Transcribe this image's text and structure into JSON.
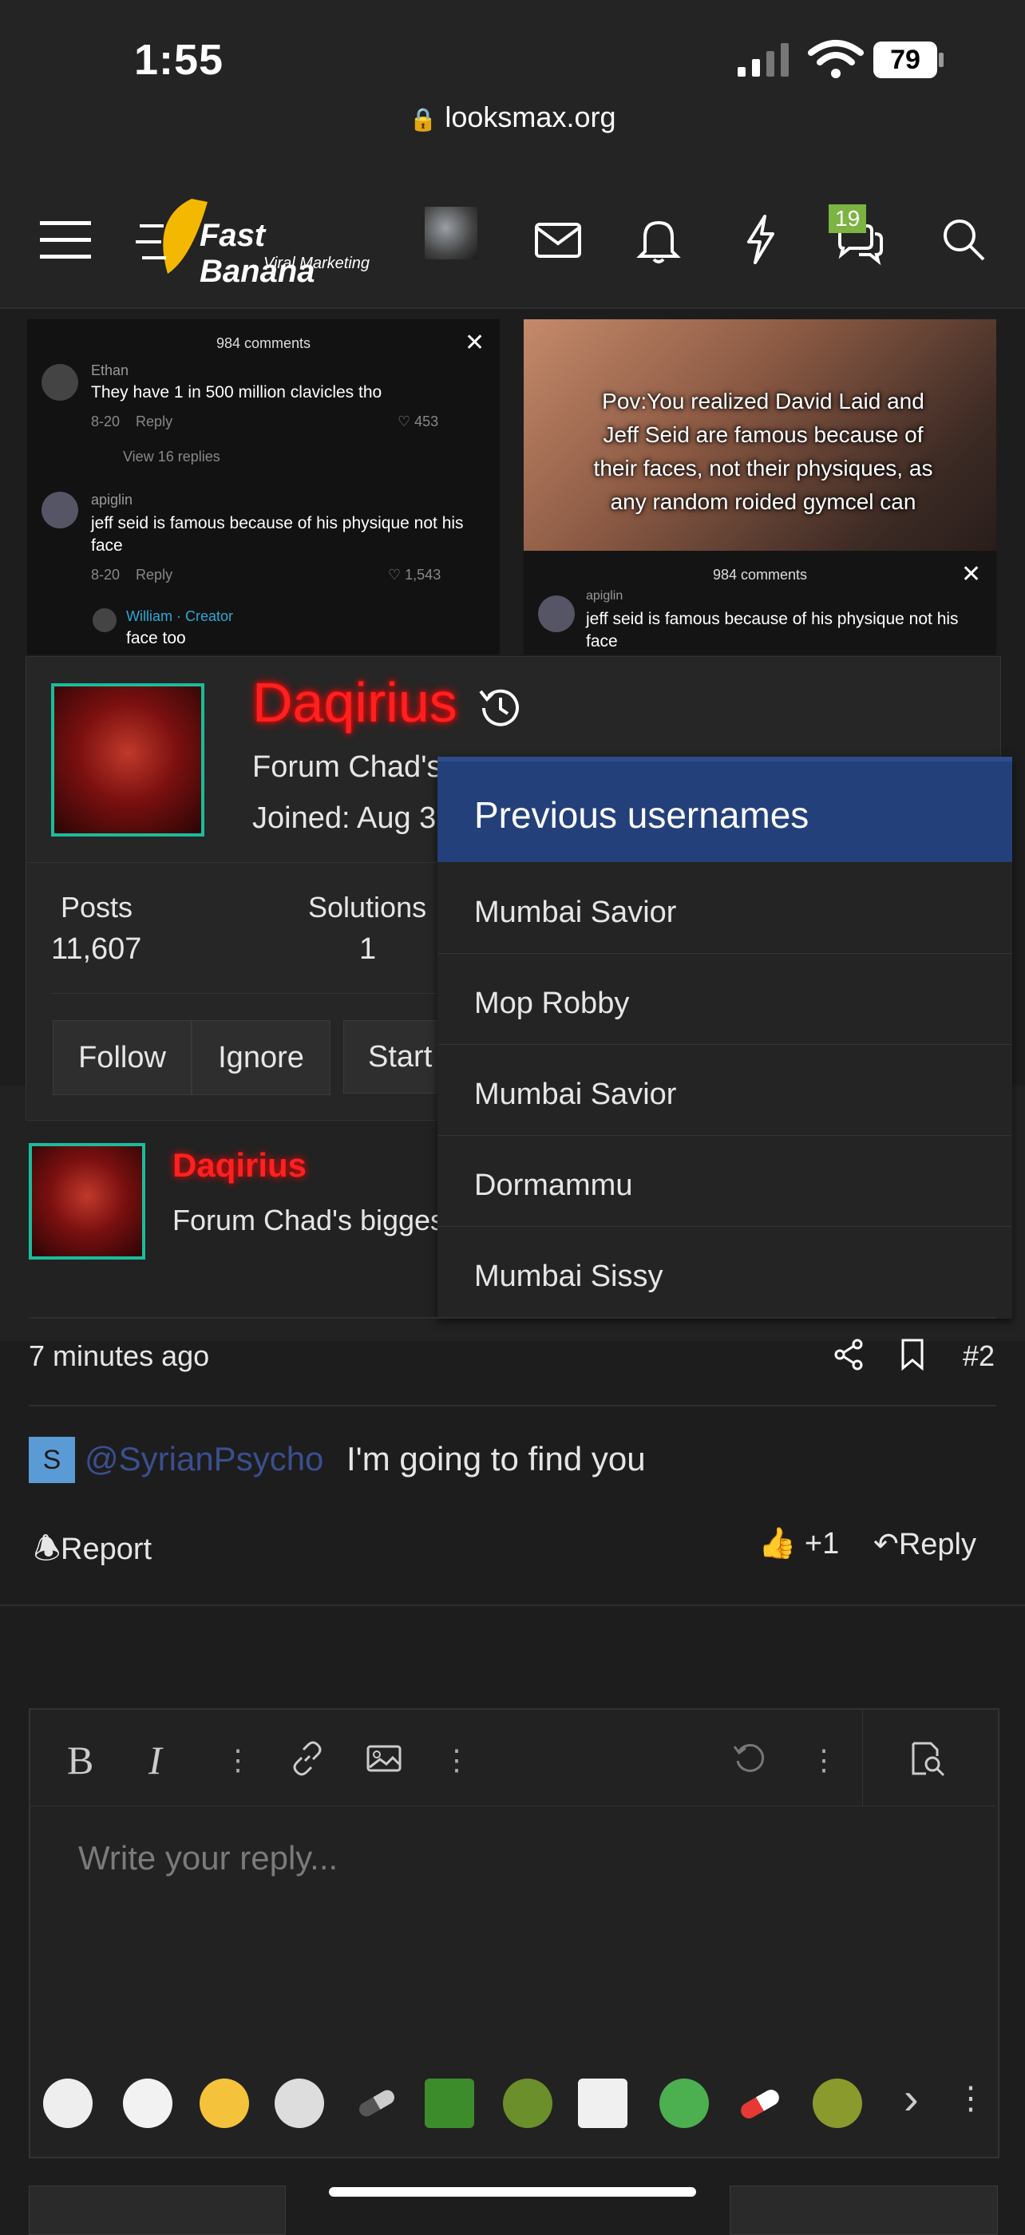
{
  "status_bar": {
    "time": "1:55",
    "battery": "79",
    "url": "looksmax.org"
  },
  "nav": {
    "logo_title": "Fast Banana",
    "logo_subtitle": "Viral Marketing",
    "chat_badge": "19"
  },
  "tiktok_left": {
    "comments_count": "984 comments",
    "c1_user": "Ethan",
    "c1_text": "They have 1 in 500 million clavicles tho",
    "c1_date": "8-20",
    "c1_reply": "Reply",
    "c1_likes": "453",
    "view_replies": "View 16 replies",
    "c2_user": "apiglin",
    "c2_text": "jeff seid is famous because of his physique not his face",
    "c2_date": "8-20",
    "c2_reply": "Reply",
    "c2_likes": "1,543",
    "c3_user": "William · Creator",
    "c3_text": "face too"
  },
  "tiktok_right": {
    "caption": "Pov:You realized David Laid and Jeff Seid are famous because of their faces, not their physiques, as any random roided gymcel can",
    "comments_count": "984 comments",
    "c1_user": "apiglin",
    "c1_text": "jeff seid is famous because of his physique not his face"
  },
  "profile": {
    "username": "Daqirius",
    "title": "Forum Chad's",
    "joined": "Joined: Aug 3",
    "posts_label": "Posts",
    "posts_value": "11,607",
    "solutions_label": "Solutions",
    "solutions_value": "1",
    "follow": "Follow",
    "ignore": "Ignore",
    "start": "Start"
  },
  "previous_usernames": {
    "title": "Previous usernames",
    "items": [
      "Mumbai Savior",
      "Mop Robby",
      "Mumbai Savior",
      "Dormammu",
      "Mumbai Sissy"
    ]
  },
  "post": {
    "username": "Daqirius",
    "title": "Forum Chad's bigges",
    "time": "7 minutes ago",
    "number": "#2",
    "mention_initial": "S",
    "mention": "@SyrianPsycho",
    "message": "I'm going to find you",
    "report": "Report",
    "likes": "+1",
    "reply": "Reply"
  },
  "editor": {
    "placeholder": "Write your reply..."
  }
}
